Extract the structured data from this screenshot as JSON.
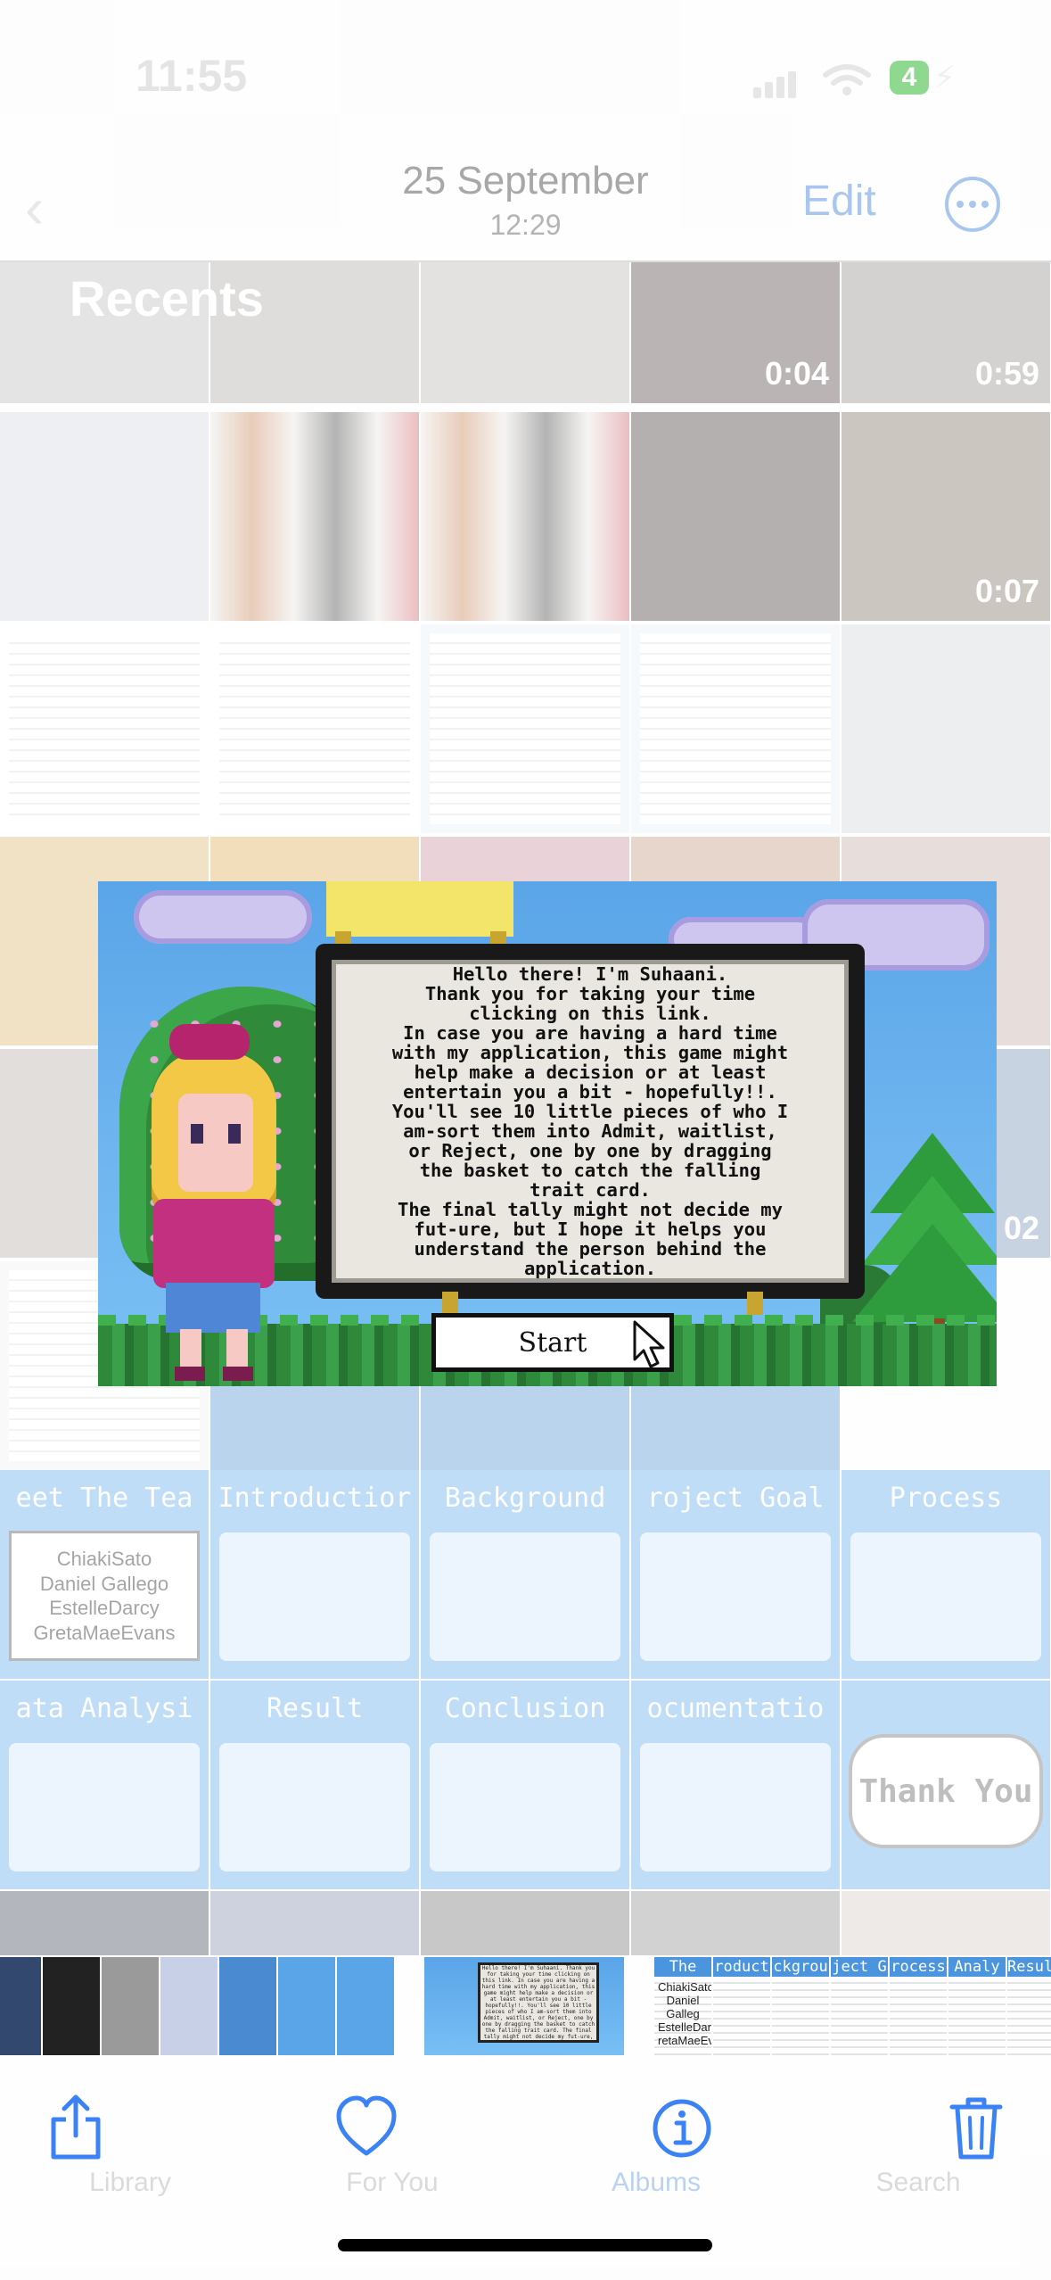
{
  "status_bar": {
    "time": "11:55",
    "battery_level": "4"
  },
  "header": {
    "date": "25 September",
    "time": "12:29",
    "edit_label": "Edit",
    "more_icon": "ellipsis-circle-icon"
  },
  "library": {
    "section_title": "Recents",
    "video_durations": [
      "0:04",
      "0:59",
      "0:07",
      "02"
    ]
  },
  "game_screen": {
    "dialog_lines": "Hello there! I'm Suhaani.\nThank you for taking your time\nclicking on this link.\nIn case you are having a hard time\nwith my application, this game might\nhelp make a decision or at least\nentertain you a bit - hopefully!!.\nYou'll see 10 little pieces of who I\nam-sort them into Admit, waitlist,\nor Reject, one by one by dragging\nthe basket to catch the falling\ntrait card.\nThe final tally might not decide my\nfut-ure, but I hope it helps you\nunderstand the person behind the\napplication.",
    "start_label": "Start"
  },
  "slides": {
    "row1": [
      "eet The Tea",
      "Introductior",
      "Background",
      "roject Goal",
      "Process"
    ],
    "row2": [
      "ata Analysi",
      "Result",
      "Conclusion",
      "ocumentatio",
      "Thank You"
    ],
    "team_names": [
      "ChiakiSato",
      "Daniel Gallego",
      "EstelleDarcy",
      "GretaMaeEvans"
    ]
  },
  "filmstrip": {
    "strip_titles": [
      "The",
      "roduct",
      "ckgrou",
      "ject G",
      "rocess",
      "Analy",
      "Resul"
    ],
    "team_names": [
      "ChiakiSato",
      "Daniel Galleg",
      "EstelleDarcy",
      "retaMaeEvan"
    ]
  },
  "toolbar": {
    "ghost_tabs": [
      "Library",
      "For You",
      "Albums",
      "Search"
    ],
    "share_icon": "share-icon",
    "favorite_icon": "heart-icon",
    "info_icon": "info-icon",
    "delete_icon": "trash-icon"
  },
  "colors": {
    "accent": "#3b82f6",
    "sky": "#5aa5e8",
    "dialog_bg": "#e9e7e0"
  }
}
